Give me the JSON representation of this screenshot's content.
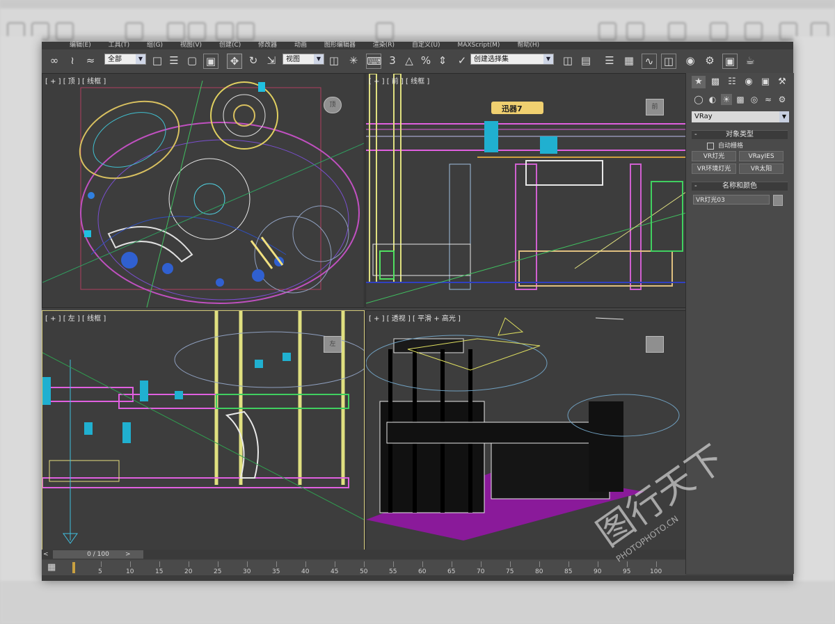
{
  "menu": [
    "编辑(E)",
    "工具(T)",
    "组(G)",
    "视图(V)",
    "创建(C)",
    "修改器",
    "动画",
    "图形编辑器",
    "渲染(R)",
    "自定义(U)",
    "MAXScript(M)",
    "帮助(H)"
  ],
  "toolbar": {
    "selection_filter": "全部",
    "ref_coord": "视图",
    "named_selection": "创建选择集",
    "snap_3": "3"
  },
  "viewports": {
    "top": {
      "label": "[ + ] [ 顶 ] [ 线框 ]",
      "cube": "顶"
    },
    "front": {
      "label": "[ + ] [ 前 ] [ 线框 ]",
      "cube": "前",
      "sign": "迅器7"
    },
    "left": {
      "label": "[ + ] [ 左 ] [ 线框 ]",
      "cube": "左"
    },
    "persp": {
      "label": "[ + ] [ 透视 ] [ 平滑 + 高光 ]"
    }
  },
  "command_panel": {
    "renderer": "VRay",
    "object_type_title": "对象类型",
    "autogrid": "自动栅格",
    "buttons": [
      "VR灯光",
      "VRayIES",
      "VR环境灯光",
      "VR太阳"
    ],
    "name_color_title": "名称和颜色",
    "object_name": "VR灯光03"
  },
  "timeline": {
    "frame_display": "0 / 100",
    "ticks": [
      "5",
      "10",
      "15",
      "20",
      "25",
      "30",
      "35",
      "40",
      "45",
      "50",
      "55",
      "60",
      "65",
      "70",
      "75",
      "80",
      "85",
      "90",
      "95",
      "100"
    ]
  },
  "watermark": {
    "main": "图行天下",
    "sub": "PHOTOPHOTO.CN"
  }
}
